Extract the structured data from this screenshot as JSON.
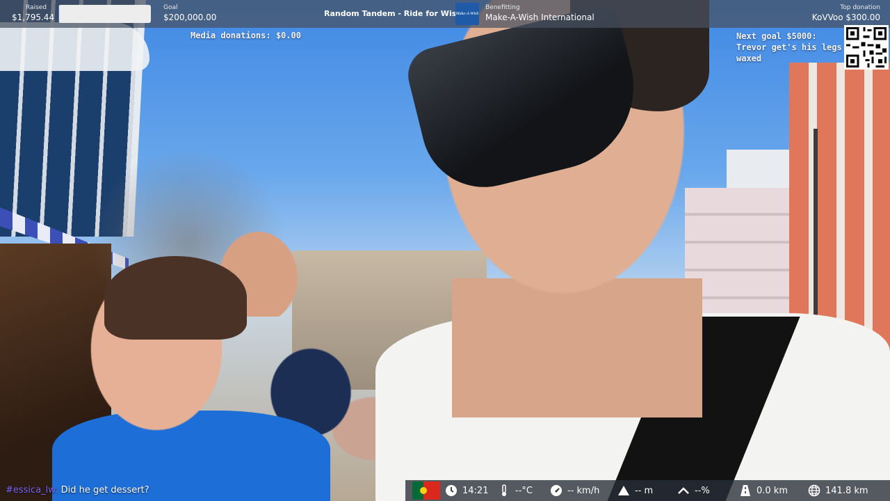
{
  "overlay_top": {
    "raised_label": "Raised",
    "raised_value": "$1,795.44",
    "progress_fraction": 0.009,
    "goal_label": "Goal",
    "goal_value": "$200,000.00",
    "stream_title": "Random Tandem - Ride for Wishes",
    "charity_logo_text": "Make-A-Wish",
    "benefitting_label": "Benefitting",
    "benefitting_value": "Make-A-Wish International",
    "top_donation_label": "Top donation",
    "top_donation_value": "KoVVoo $300.00",
    "media_donations": "Media donations: $0.00",
    "next_goal_line1": "Next goal $5000:",
    "next_goal_line2": "Trevor get's his legs",
    "next_goal_line3": "waxed"
  },
  "chat": {
    "username": "#essica_lw:",
    "message": "Did he get dessert?"
  },
  "stats_bar": {
    "country_flag": "portugal-flag",
    "time": "14:21",
    "temperature": "--°C",
    "speed": "-- km/h",
    "altitude": "-- m",
    "incline": "--%",
    "distance_today": "0.0 km",
    "distance_total": "141.8 km"
  },
  "colors": {
    "bar_bg": "#46505f",
    "progress_fill": "#3a7bd5",
    "chat_username": "#7a63f0"
  }
}
